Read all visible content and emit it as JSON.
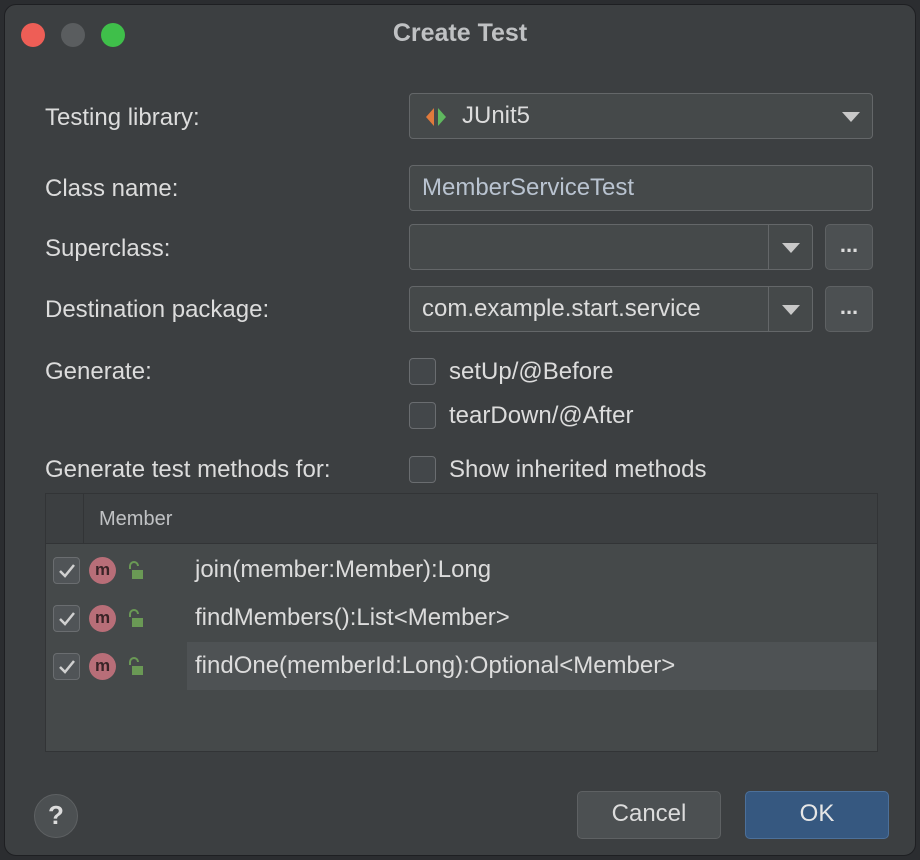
{
  "window": {
    "title": "Create Test"
  },
  "form": {
    "testing_library_label": "Testing library:",
    "testing_library_value": "JUnit5",
    "class_name_label": "Class name:",
    "class_name_value": "MemberServiceTest",
    "superclass_label": "Superclass:",
    "superclass_value": "",
    "destination_label": "Destination package:",
    "destination_value": "com.example.start.service",
    "ellipsis": "...",
    "generate_label": "Generate:",
    "setup_label": "setUp/@Before",
    "setup_checked": false,
    "teardown_label": "tearDown/@After",
    "teardown_checked": false,
    "methods_for_label": "Generate test methods for:",
    "show_inherited_label": "Show inherited methods",
    "show_inherited_checked": false
  },
  "table": {
    "header": "Member",
    "rows": [
      {
        "icon": "m",
        "signature": "join(member:Member):Long",
        "checked": true
      },
      {
        "icon": "m",
        "signature": "findMembers():List<Member>",
        "checked": true
      },
      {
        "icon": "m",
        "signature": "findOne(memberId:Long):Optional<Member>",
        "checked": true
      }
    ]
  },
  "footer": {
    "help": "?",
    "cancel": "Cancel",
    "ok": "OK"
  },
  "colors": {
    "accent": "#365880",
    "method_icon": "#b86e78",
    "lock": "#6a9955"
  }
}
